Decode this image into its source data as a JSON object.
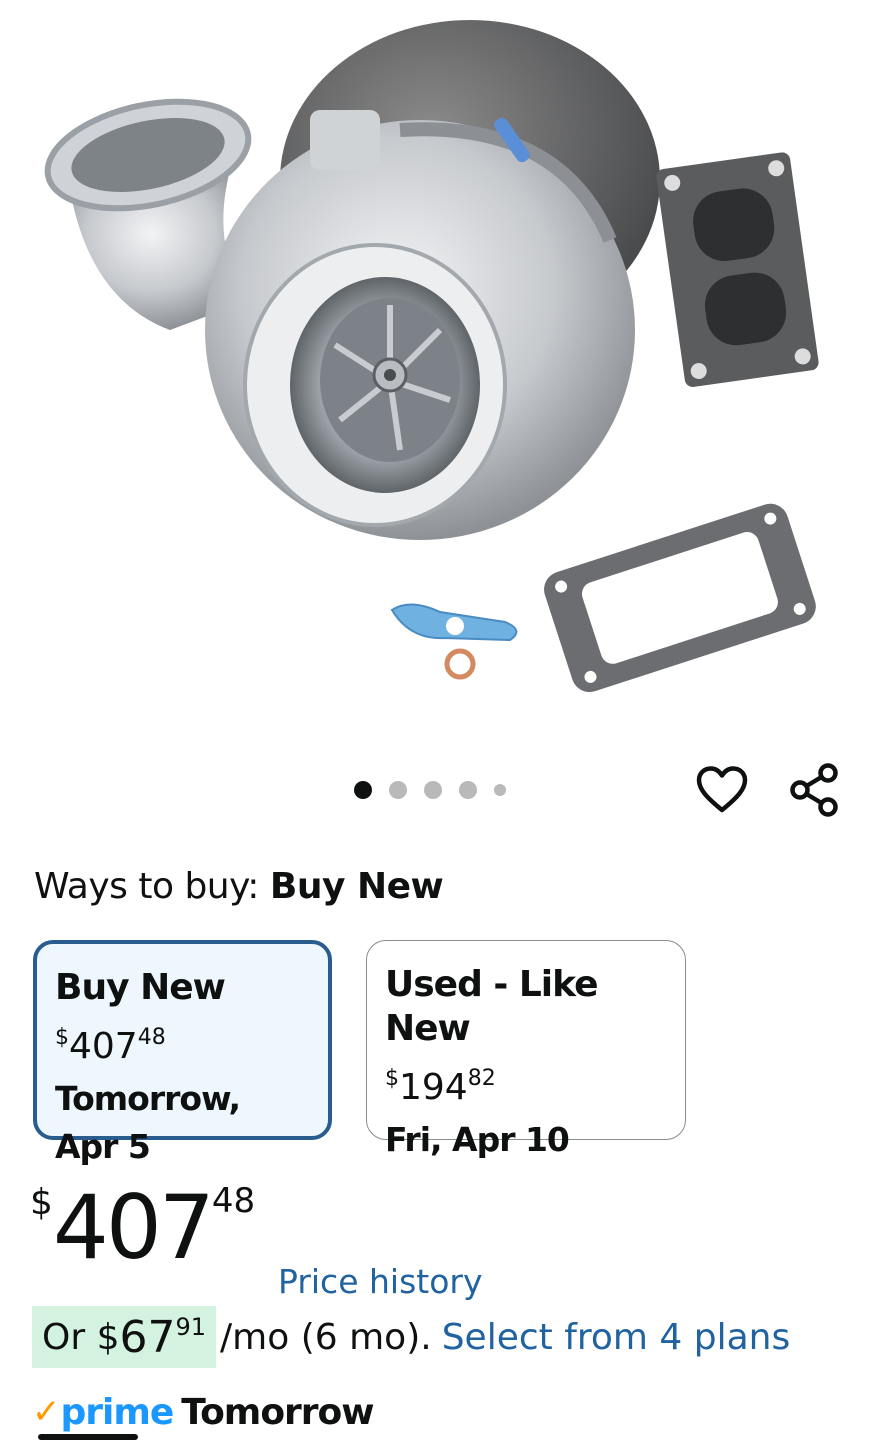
{
  "product": {
    "image_alt": "Turbocharger with gaskets",
    "carousel": {
      "total": 5,
      "active_index": 0
    }
  },
  "icons": {
    "wishlist": "heart-icon",
    "share": "share-icon"
  },
  "ways_to_buy": {
    "label": "Ways to buy:",
    "selected": "Buy New"
  },
  "options": [
    {
      "title": "Buy New",
      "price_symbol": "$",
      "price_dollars": "407",
      "price_cents": "48",
      "delivery": "Tomorrow, Apr 5",
      "selected": true
    },
    {
      "title": "Used - Like New",
      "price_symbol": "$",
      "price_dollars": "194",
      "price_cents": "82",
      "delivery": "Fri, Apr 10",
      "selected": false
    }
  ],
  "price": {
    "symbol": "$",
    "dollars": "407",
    "cents": "48",
    "history_link": "Price history"
  },
  "financing": {
    "prefix": "Or",
    "symbol": "$",
    "dollars": "67",
    "cents": "91",
    "term": "/mo (6 mo).",
    "plans_link": "Select from 4 plans"
  },
  "prime": {
    "logo_text": "prime",
    "delivery": "Tomorrow"
  },
  "colors": {
    "link": "#2162a1",
    "selected_border": "#2a5d8f",
    "selected_bg": "#edf7fd",
    "financing_bg": "#d4f2e0",
    "prime_blue": "#1a98ff",
    "prime_check": "#ff9900"
  }
}
